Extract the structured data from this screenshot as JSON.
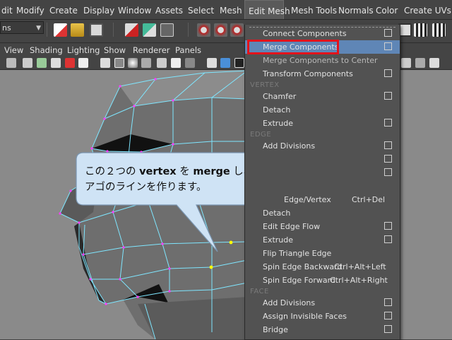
{
  "menubar": {
    "items": [
      "dit",
      "Modify",
      "Create",
      "Display",
      "Window",
      "Assets",
      "Select",
      "Mesh",
      "Edit Mesh",
      "Mesh Tools",
      "Normals",
      "Color",
      "Create UVs"
    ],
    "active": "Edit Mesh"
  },
  "toolbar": {
    "mode_combo": "ns"
  },
  "panel_menu": {
    "items": [
      "View",
      "Shading",
      "Lighting",
      "Show",
      "Renderer",
      "Panels"
    ]
  },
  "edit_mesh_menu": {
    "top_items": [
      {
        "label": "Connect Components",
        "option_box": true
      },
      {
        "label": "Merge Components",
        "option_box": true,
        "highlighted": true
      },
      {
        "label": "Merge Components to Center",
        "option_box": false
      },
      {
        "label": "Transform Components",
        "option_box": true
      }
    ],
    "vertex_header": "VERTEX",
    "vertex_items": [
      {
        "label": "Chamfer",
        "option_box": true
      },
      {
        "label": "Detach",
        "option_box": false
      },
      {
        "label": "Extrude",
        "option_box": true
      }
    ],
    "edge_header": "EDGE",
    "edge_items": [
      {
        "label": "Add Divisions",
        "option_box": true
      },
      {
        "label": "",
        "option_box": true
      },
      {
        "label": "",
        "option_box": true
      },
      {
        "label": "Edge/Vertex",
        "shortcut": "Ctrl+Del",
        "option_box": false
      },
      {
        "label": "Detach",
        "option_box": false
      },
      {
        "label": "Edit Edge Flow",
        "option_box": true
      },
      {
        "label": "Extrude",
        "option_box": true
      },
      {
        "label": "Flip Triangle Edge",
        "option_box": false
      },
      {
        "label": "Spin Edge Backward",
        "shortcut": "Ctrl+Alt+Left",
        "option_box": false
      },
      {
        "label": "Spin Edge Forward",
        "shortcut": "Ctrl+Alt+Right",
        "option_box": false
      }
    ],
    "face_header": "FACE",
    "face_items": [
      {
        "label": "Add Divisions",
        "option_box": true
      },
      {
        "label": "Assign Invisible Faces",
        "option_box": true
      },
      {
        "label": "Bridge",
        "option_box": true
      }
    ]
  },
  "callout": {
    "line1_a": "この２つの ",
    "line1_b": "vertex",
    "line1_c": " を ",
    "line1_d": "merge",
    "line1_e": " し、",
    "line2": "アゴのラインを作ります。"
  },
  "colors": {
    "highlight": "#5f86b6",
    "annotation_red": "#e3131b",
    "wire": "#7fe6ff",
    "callout_fill": "#cfe3f5",
    "selected_vertex": "#ffff00"
  }
}
